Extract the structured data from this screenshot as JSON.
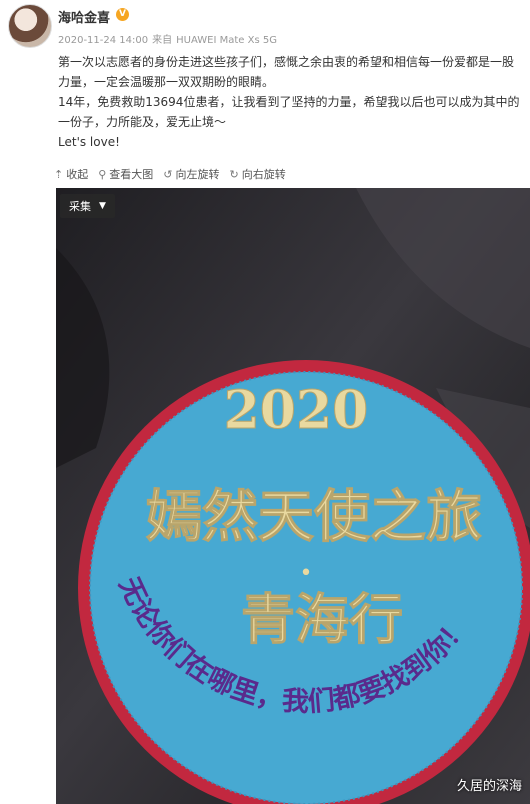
{
  "post": {
    "username": "海哈金喜",
    "verified_icon": "verified-badge-icon",
    "timestamp": "2020-11-24 14:00",
    "source_prefix": "来自",
    "source_device": "HUAWEI Mate Xs 5G",
    "paragraphs": [
      "第一次以志愿者的身份走进这些孩子们，感慨之余由衷的希望和相信每一份爱都是一股力量，一定会温暖那一双双期盼的眼睛。",
      "14年，免费救助13694位患者，让我看到了坚持的力量，希望我以后也可以成为其中的一份子，力所能及，爱无止境～",
      "Let's love!"
    ]
  },
  "toolbar": {
    "collapse": "收起",
    "view_large": "查看大图",
    "rotate_left": "向左旋转",
    "rotate_right": "向右旋转"
  },
  "photo": {
    "tag_label": "采集",
    "badge_year": "2020",
    "badge_title": "嫣然天使之旅",
    "badge_dot": "•",
    "badge_place": "青海行",
    "badge_ring_text": "无论你们在哪里，我们都要找到你！",
    "watermark": "久居的深海",
    "colors": {
      "jacket": "#2b2a2e",
      "badge_fill": "#47a9d2",
      "badge_border": "#c2283f",
      "embroidery_gold": "#e9d9a0",
      "ring_text": "#5a2a8c"
    }
  }
}
